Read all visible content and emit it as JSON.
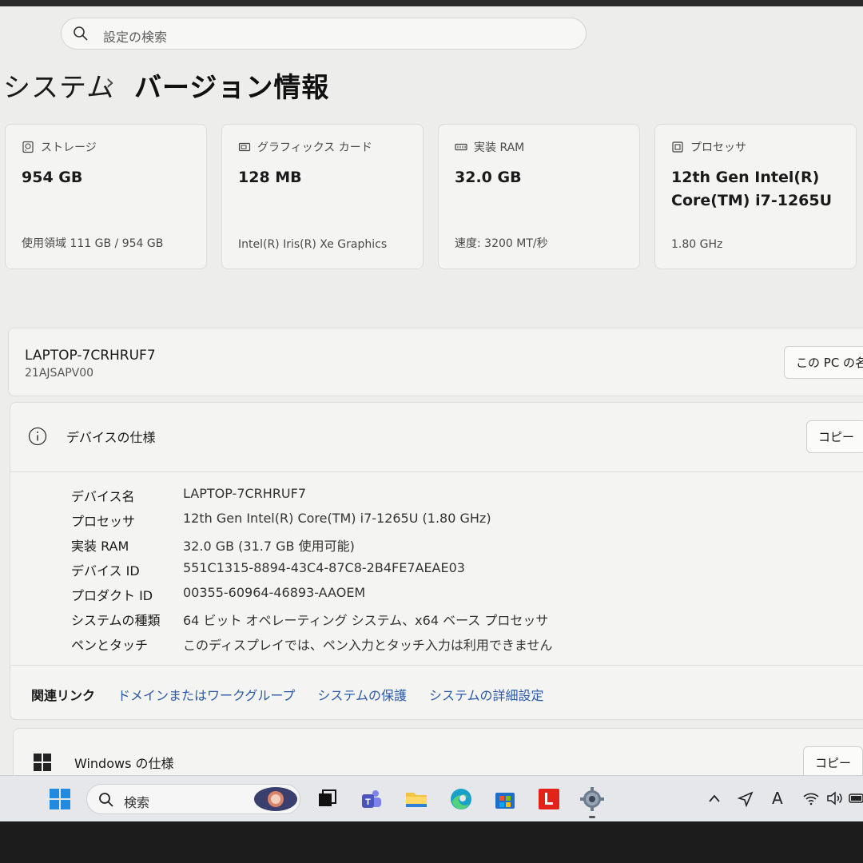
{
  "search": {
    "placeholder": "設定の検索"
  },
  "breadcrumb": {
    "parent": "システム",
    "separator": "›",
    "current": "バージョン情報"
  },
  "cards": [
    {
      "icon": "storage-icon",
      "label": "ストレージ",
      "value": "954 GB",
      "sub": "使用領域 111 GB / 954 GB"
    },
    {
      "icon": "graphics-card-icon",
      "label": "グラフィックス カード",
      "value": "128 MB",
      "sub": "Intel(R) Iris(R) Xe Graphics"
    },
    {
      "icon": "ram-icon",
      "label": "実装 RAM",
      "value": "32.0 GB",
      "sub": "速度: 3200 MT/秒"
    },
    {
      "icon": "processor-icon",
      "label": "プロセッサ",
      "value": "12th Gen Intel(R) Core(TM) i7-1265U",
      "sub": "1.80 GHz"
    }
  ],
  "device": {
    "name": "LAPTOP-7CRHRUF7",
    "model": "21AJSAPV00",
    "rename_label": "この PC の名"
  },
  "device_spec": {
    "title": "デバイスの仕様",
    "copy_label": "コピー",
    "rows": [
      {
        "key": "デバイス名",
        "value": "LAPTOP-7CRHRUF7"
      },
      {
        "key": "プロセッサ",
        "value": "12th Gen Intel(R) Core(TM) i7-1265U (1.80 GHz)"
      },
      {
        "key": "実装 RAM",
        "value": "32.0 GB (31.7 GB 使用可能)"
      },
      {
        "key": "デバイス ID",
        "value": "551C1315-8894-43C4-87C8-2B4FE7AEAE03"
      },
      {
        "key": "プロダクト ID",
        "value": "00355-60964-46893-AAOEM"
      },
      {
        "key": "システムの種類",
        "value": "64 ビット オペレーティング システム、x64 ベース プロセッサ"
      },
      {
        "key": "ペンとタッチ",
        "value": "このディスプレイでは、ペン入力とタッチ入力は利用できません"
      }
    ],
    "related_label": "関連リンク",
    "links": [
      "ドメインまたはワークグループ",
      "システムの保護",
      "システムの詳細設定"
    ]
  },
  "windows_spec": {
    "title": "Windows の仕様",
    "copy_label": "コピー"
  },
  "taskbar": {
    "search_placeholder": "検索",
    "tray_ime": "A"
  }
}
